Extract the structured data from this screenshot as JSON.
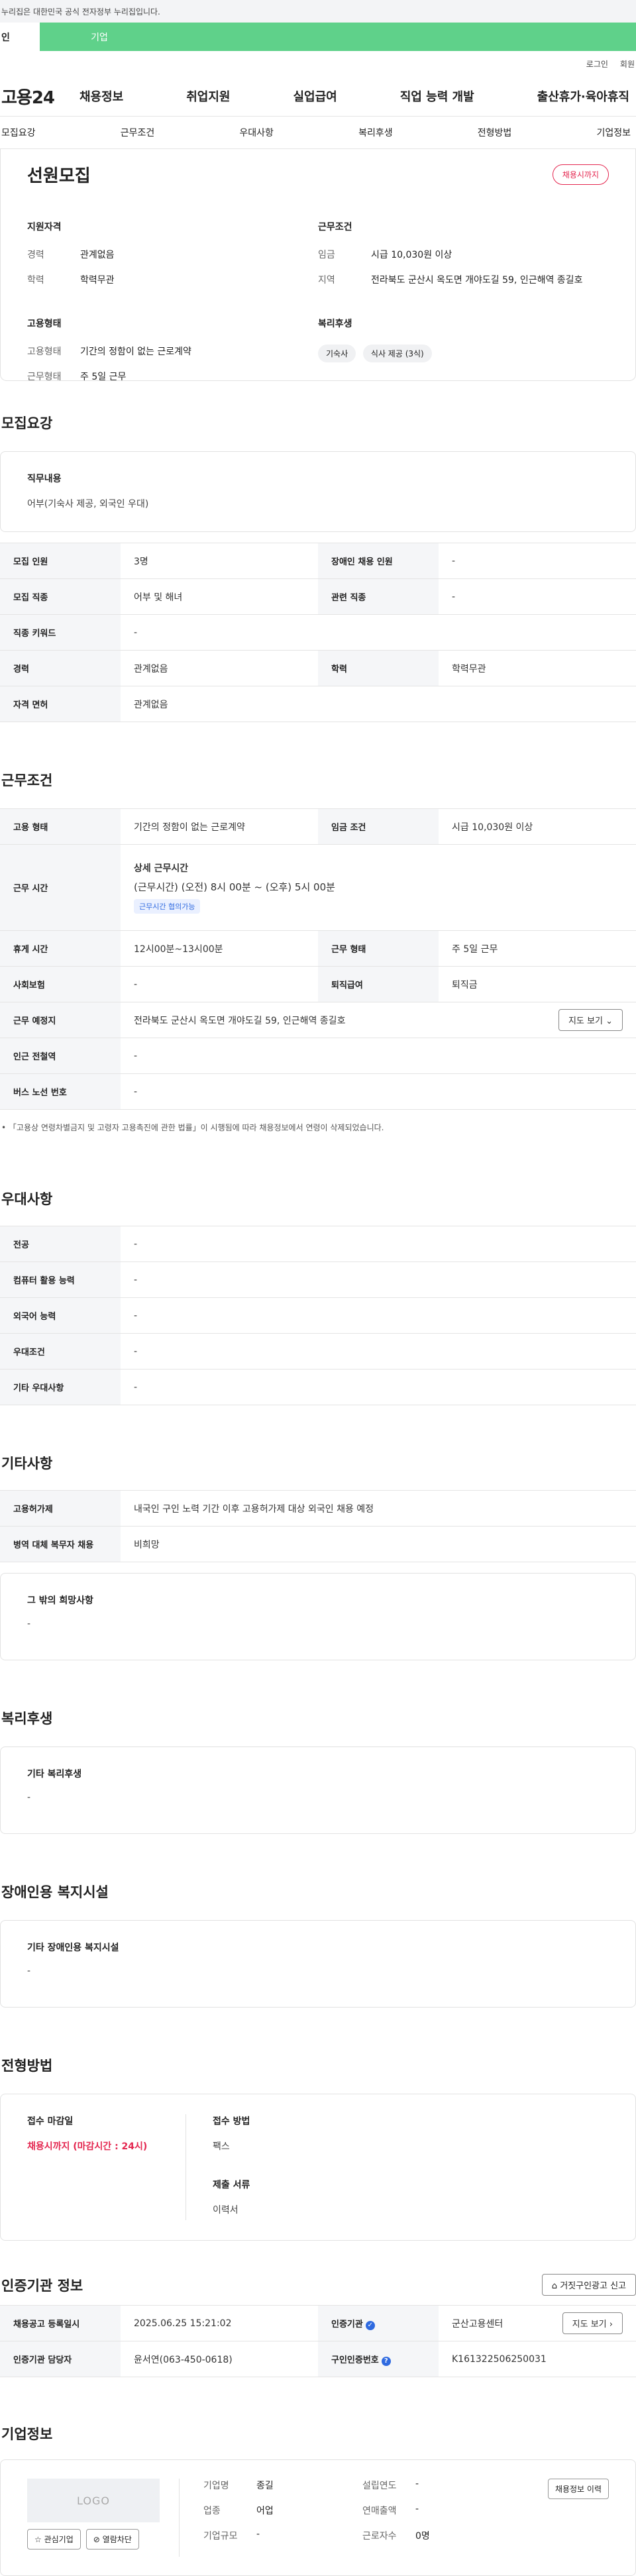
{
  "top": {
    "notice": "누리집은 대한민국 공식 전자정부 누리집입니다."
  },
  "tabs": {
    "person": "인",
    "company": "기업"
  },
  "util": {
    "login": "로그인",
    "join": "회원"
  },
  "gnb": {
    "logo": "고용24",
    "menu": [
      "채용정보",
      "취업지원",
      "실업급여",
      "직업 능력 개발",
      "출산휴가·육아휴직"
    ]
  },
  "subnav": [
    "모집요강",
    "근무조건",
    "우대사항",
    "복리후생",
    "전형방법",
    "기업정보"
  ],
  "summary": {
    "title": "선원모집",
    "badge": "채용시까지",
    "qual_h": "지원자격",
    "career_k": "경력",
    "career_v": "관계없음",
    "edu_k": "학력",
    "edu_v": "학력무관",
    "cond_h": "근무조건",
    "wage_k": "임금",
    "wage_v": "시급 10,030원 이상",
    "region_k": "지역",
    "region_v": "전라북도 군산시 옥도면 개야도길 59, 인근해역 종길호",
    "emp_h": "고용형태",
    "emptype_k": "고용형태",
    "emptype_v": "기간의 정함이 없는 근로계약",
    "worktype_k": "근무형태",
    "worktype_v": "주 5일 근무",
    "welfare_h": "복리후생",
    "chips": [
      "기숙사",
      "식사 제공 (3식)"
    ]
  },
  "recruit": {
    "title": "모집요강",
    "job_label": "직무내용",
    "job_text": "어부(기숙사 제공, 외국인 우대)",
    "rows": [
      [
        "모집 인원",
        "3명",
        "장애인 채용 인원",
        "-"
      ],
      [
        "모집 직종",
        "어부 및 해녀",
        "관련 직종",
        "-"
      ],
      [
        "직종 키워드",
        "-"
      ],
      [
        "경력",
        "관계없음",
        "학력",
        "학력무관"
      ],
      [
        "자격 면허",
        "관계없음"
      ]
    ]
  },
  "work": {
    "title": "근무조건",
    "emp_k": "고용 형태",
    "emp_v": "기간의 정함이 없는 근로계약",
    "wage_k": "임금 조건",
    "wage_v": "시급 10,030원 이상",
    "time_k": "근무 시간",
    "time_h": "상세 근무시간",
    "time_v": "(근무시간) (오전) 8시 00분 ~ (오후) 5시 00분",
    "time_chip": "근무시간 협의가능",
    "rest_k": "휴게 시간",
    "rest_v": "12시00분~13시00분",
    "form_k": "근무 형태",
    "form_v": "주 5일 근무",
    "ins_k": "사회보험",
    "ins_v": "-",
    "ret_k": "퇴직급여",
    "ret_v": "퇴직금",
    "place_k": "근무 예정지",
    "place_v": "전라북도 군산시 옥도면 개야도길 59, 인근해역 종길호",
    "map_btn": "지도 보기",
    "subway_k": "인근 전철역",
    "subway_v": "-",
    "bus_k": "버스 노선 번호",
    "bus_v": "-",
    "note": "「고용상 연령차별금지 및 고령자 고용촉진에 관한 법률」이 시행됨에 따라 채용정보에서 연령이 삭제되었습니다."
  },
  "pref": {
    "title": "우대사항",
    "rows": [
      [
        "전공",
        "-"
      ],
      [
        "컴퓨터 활용 능력",
        "-"
      ],
      [
        "외국어 능력",
        "-"
      ],
      [
        "우대조건",
        "-"
      ],
      [
        "기타 우대사항",
        "-"
      ]
    ]
  },
  "etc": {
    "title": "기타사항",
    "rows": [
      [
        "고용허가제",
        "내국인 구인 노력 기간 이후 고용허가제 대상 외국인 채용 예정"
      ],
      [
        "병역 대체 복무자 채용",
        "비희망"
      ]
    ],
    "box_label": "그 밖의 희망사항",
    "box_text": "-"
  },
  "welfare": {
    "title": "복리후생",
    "label": "기타 복리후생",
    "text": "-"
  },
  "disabled": {
    "title": "장애인용 복지시설",
    "label": "기타 장애인용 복지시설",
    "text": "-"
  },
  "process": {
    "title": "전형방법",
    "deadline_label": "접수 마감일",
    "deadline_text": "채용시까지 (마감시간 : 24시)",
    "method_label": "접수 방법",
    "method_text": "팩스",
    "docs_label": "제출 서류",
    "docs_text": "이력서"
  },
  "cert": {
    "title": "인증기관 정보",
    "report_btn": "거짓구인광고 신고",
    "reg_k": "채용공고 등록일시",
    "reg_v": "2025.06.25 15:21:02",
    "org_k": "인증기관",
    "org_v": "군산고용센터",
    "map_btn": "지도 보기",
    "mgr_k": "인증기관 담당자",
    "mgr_v": "윤서연(063-450-0618)",
    "id_k": "구인인증번호",
    "id_v": "K161322506250031"
  },
  "company": {
    "title": "기업정보",
    "logo": "LOGO",
    "fav_btn": "관심기업",
    "block_btn": "열람차단",
    "name_k": "기업명",
    "name_v": "종길",
    "ind_k": "업종",
    "ind_v": "어업",
    "size_k": "기업규모",
    "size_v": "-",
    "est_k": "설립연도",
    "est_v": "-",
    "rev_k": "연매출액",
    "rev_v": "-",
    "emp_k": "근로자수",
    "emp_v": "0명",
    "jobs_btn": "채용정보 이력"
  }
}
